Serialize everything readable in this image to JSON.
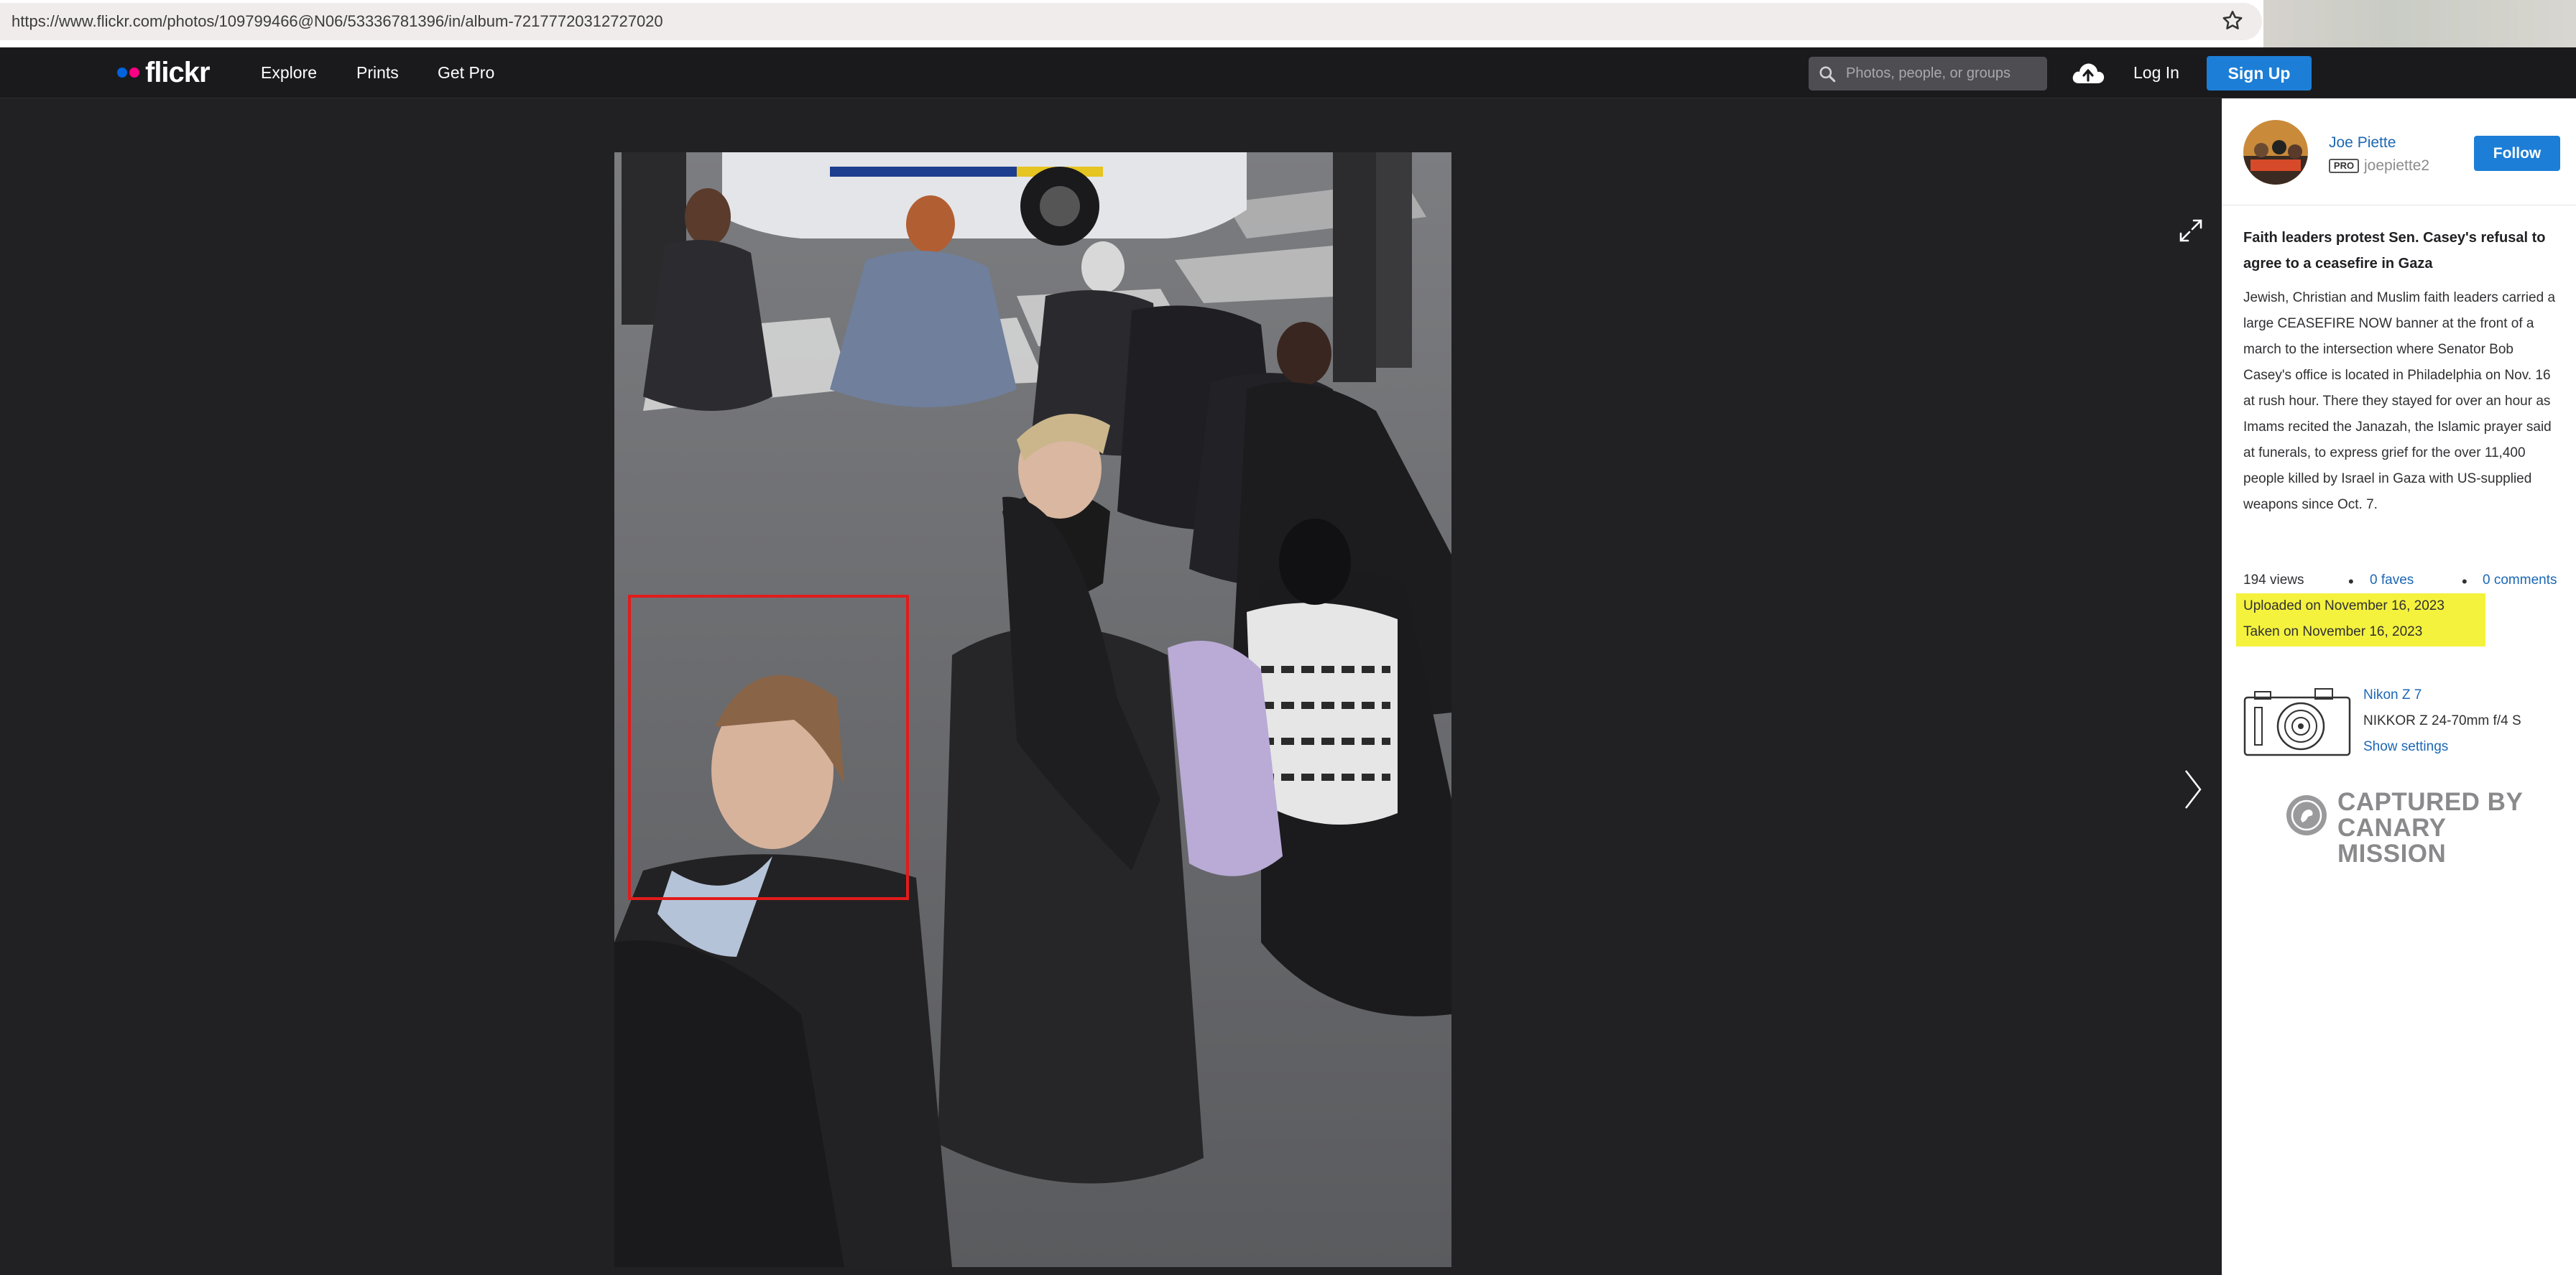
{
  "browser": {
    "url": "https://www.flickr.com/photos/109799466@N06/53336781396/in/album-72177720312727020",
    "star_icon": "star-outline-icon"
  },
  "nav": {
    "brand": "flickr",
    "links": [
      "Explore",
      "Prints",
      "Get Pro"
    ],
    "search_placeholder": "Photos, people, or groups",
    "login": "Log In",
    "signup": "Sign Up",
    "brand_colors": {
      "blue": "#0063dc",
      "pink": "#ff0084",
      "button": "#1c7ed6"
    }
  },
  "photo": {
    "highlight_box_color": "#e21b1b"
  },
  "owner": {
    "name": "Joe Piette",
    "pro_badge": "PRO",
    "handle": "joepiette2",
    "follow": "Follow"
  },
  "details": {
    "title": "Faith leaders protest Sen. Casey's refusal to agree to a ceasefire in Gaza",
    "description": "Jewish, Christian and Muslim faith leaders carried a large CEASEFIRE NOW banner at the front of a march to the intersection where Senator Bob Casey's office is located in Philadelphia on Nov. 16 at rush hour. There they stayed for over an hour as Imams recited the Janazah, the Islamic prayer said at funerals, to express grief for the over 11,400 people killed by Israel in Gaza with US-supplied weapons since Oct. 7.",
    "views": "194 views",
    "faves": "0 faves",
    "comments": "0 comments",
    "uploaded": "Uploaded on November 16, 2023",
    "taken": "Taken on November 16, 2023",
    "highlight_color": "#f4f23c"
  },
  "camera": {
    "model": "Nikon Z 7",
    "lens": "NIKKOR Z 24-70mm f/4 S",
    "settings_link": "Show settings"
  },
  "watermark": {
    "line1": "CAPTURED BY",
    "line2": "CANARY MISSION"
  }
}
